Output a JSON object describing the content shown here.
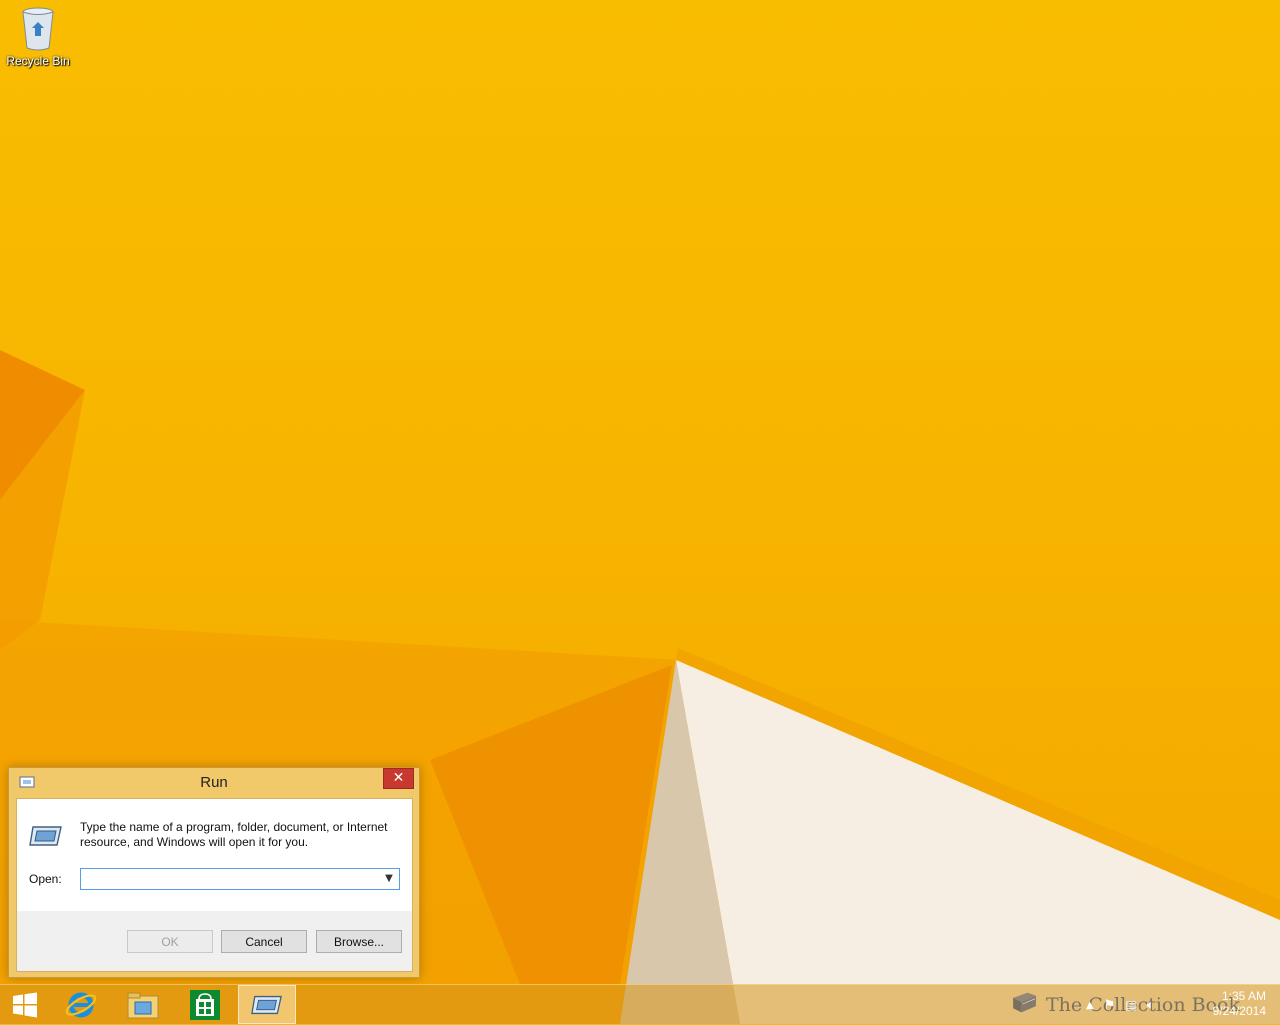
{
  "desktop": {
    "icons": [
      {
        "label": "Recycle Bin",
        "icon": "recycle-bin-icon"
      }
    ]
  },
  "run_dialog": {
    "title": "Run",
    "close_symbol": "✕",
    "description": "Type the name of a program, folder, document, or Internet resource, and Windows will open it for you.",
    "open_label": "Open:",
    "open_value": "",
    "buttons": {
      "ok": "OK",
      "cancel": "Cancel",
      "browse": "Browse..."
    }
  },
  "taskbar": {
    "items": [
      {
        "name": "start",
        "icon": "windows-logo-icon"
      },
      {
        "name": "internet-explorer",
        "icon": "internet-explorer-icon"
      },
      {
        "name": "file-explorer",
        "icon": "file-explorer-icon"
      },
      {
        "name": "store",
        "icon": "store-icon"
      },
      {
        "name": "run",
        "icon": "run-icon",
        "active": true
      }
    ],
    "watermark": "The Collection Book",
    "clock": {
      "time": "1:35 AM",
      "date": "9/24/2014"
    }
  },
  "colors": {
    "wallpaper": "#f7b300",
    "dialog_frame": "#f2c96a",
    "close_button": "#c7382f",
    "input_border": "#569de5"
  }
}
